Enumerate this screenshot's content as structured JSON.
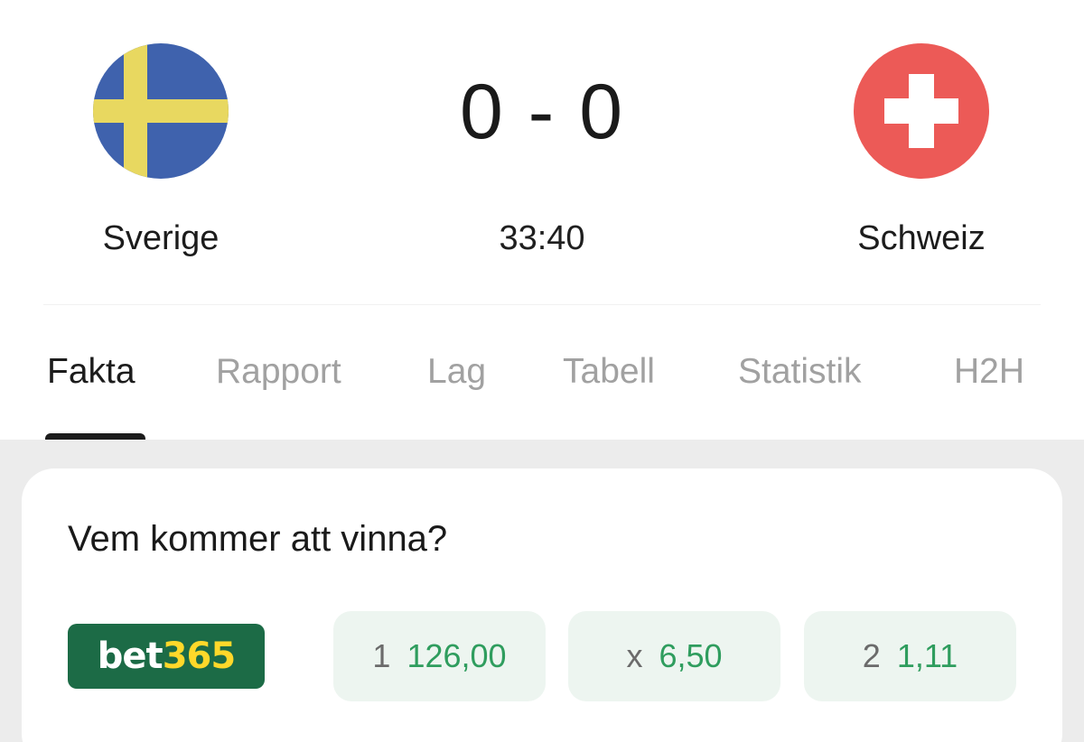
{
  "match": {
    "home_team": "Sverige",
    "away_team": "Schweiz",
    "score": "0 - 0",
    "clock": "33:40",
    "home_flag_icon": "sweden-flag-icon",
    "away_flag_icon": "switzerland-flag-icon"
  },
  "tabs": [
    {
      "label": "Fakta",
      "active": true
    },
    {
      "label": "Rapport",
      "active": false
    },
    {
      "label": "Lag",
      "active": false
    },
    {
      "label": "Tabell",
      "active": false
    },
    {
      "label": "Statistik",
      "active": false
    },
    {
      "label": "H2H",
      "active": false
    }
  ],
  "prediction": {
    "title": "Vem kommer att vinna?",
    "bookmaker_a": "bet",
    "bookmaker_b": "365",
    "odds": [
      {
        "label": "1",
        "value": "126,00"
      },
      {
        "label": "x",
        "value": "6,50"
      },
      {
        "label": "2",
        "value": "1,11"
      }
    ]
  },
  "colors": {
    "accent_green": "#2f9d5e",
    "bookmaker_green": "#1c6b46",
    "bookmaker_yellow": "#ffd82a",
    "sweden_blue": "#3f62ad",
    "sweden_yellow": "#e8d860",
    "swiss_red": "#ec5a57"
  }
}
